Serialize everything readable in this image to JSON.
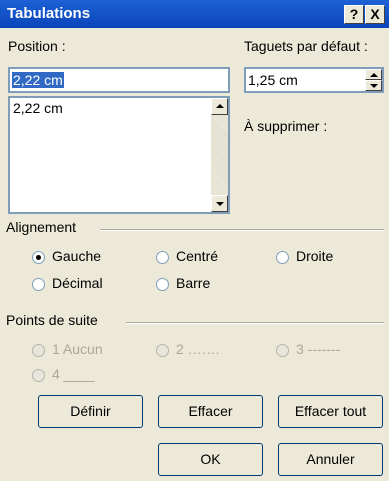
{
  "window": {
    "title": "Tabulations",
    "help_label": "?",
    "close_label": "X"
  },
  "position": {
    "label": "Position :",
    "value": "2,22 cm",
    "items": [
      "2,22 cm"
    ]
  },
  "default_tabs": {
    "label": "Taguets par défaut :",
    "value": "1,25 cm"
  },
  "to_clear": {
    "label": "À supprimer :"
  },
  "alignment": {
    "title": "Alignement",
    "options": [
      {
        "label": "Gauche",
        "checked": true
      },
      {
        "label": "Centré",
        "checked": false
      },
      {
        "label": "Droite",
        "checked": false
      },
      {
        "label": "Décimal",
        "checked": false
      },
      {
        "label": "Barre",
        "checked": false
      }
    ]
  },
  "leader": {
    "title": "Points de suite",
    "options": [
      {
        "label": "1 Aucun"
      },
      {
        "label": "2 ……."
      },
      {
        "label": "3 -------"
      },
      {
        "label": "4 ____"
      }
    ]
  },
  "buttons": {
    "set": "Définir",
    "clear": "Effacer",
    "clear_all": "Effacer tout",
    "ok": "OK",
    "cancel": "Annuler"
  }
}
